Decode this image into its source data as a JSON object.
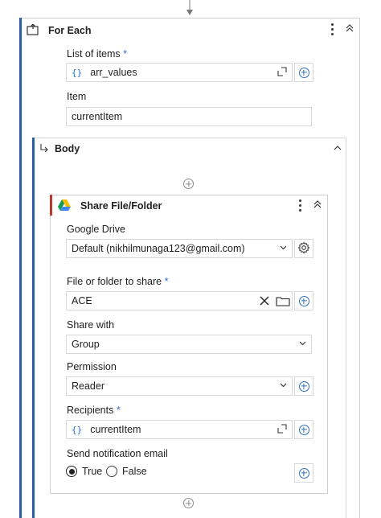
{
  "for_each": {
    "title": "For Each",
    "list_label": "List of items",
    "list_required": "*",
    "list_value": "arr_values",
    "item_label": "Item",
    "item_value": "currentItem"
  },
  "body": {
    "title": "Body"
  },
  "share": {
    "title": "Share File/Folder",
    "drive_label": "Google Drive",
    "drive_value": "Default (nikhilmunaga123@gmail.com)",
    "file_label": "File or folder to share",
    "file_required": "*",
    "file_value": "ACE",
    "share_with_label": "Share with",
    "share_with_value": "Group",
    "permission_label": "Permission",
    "permission_value": "Reader",
    "recipients_label": "Recipients",
    "recipients_required": "*",
    "recipients_value": "currentItem",
    "notify_label": "Send notification email",
    "opt_true": "True",
    "opt_false": "False",
    "selected": "True"
  },
  "colors": {
    "accent_blue": "#2a5ea8",
    "accent_red": "#c0392b",
    "plus_blue": "#2c6fbf"
  },
  "icons": {
    "curly": "{}"
  }
}
